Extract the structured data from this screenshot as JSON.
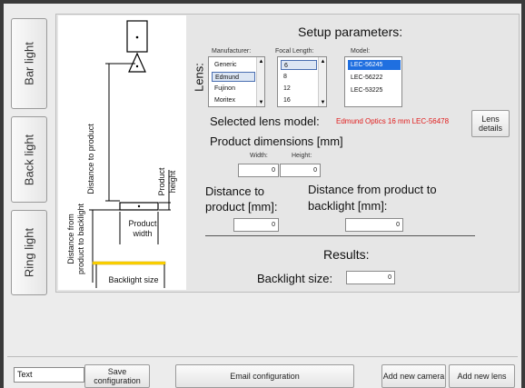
{
  "tabs": [
    "Bar light",
    "Back light",
    "Ring light"
  ],
  "diagram": {
    "distance_to_product": "Distance to product",
    "product_height_1": "Product",
    "product_height_2": "height",
    "distance_backlight_1": "Distance from",
    "distance_backlight_2": "product to backlight",
    "product_width_1": "Product",
    "product_width_2": "width",
    "backlight_size": "Backlight size"
  },
  "setup": {
    "title": "Setup parameters:",
    "lens_label": "Lens:",
    "manufacturer_header": "Manufacturer:",
    "focal_header": "Focal Length:",
    "model_header": "Model:",
    "manufacturers": [
      "Generic",
      "Edmund",
      "Fujinon",
      "Moritex"
    ],
    "focal_lengths": [
      "6",
      "8",
      "12",
      "16"
    ],
    "models": [
      "LEC-56245",
      "LEC-56222",
      "LEC-53225"
    ],
    "selected_label": "Selected lens model:",
    "selected_value": "Edmund Optics 16 mm LEC-56478",
    "lens_details_1": "Lens",
    "lens_details_2": "details",
    "product_dims_title": "Product dimensions [mm]",
    "width_label": "Width:",
    "height_label": "Height:",
    "width_value": "0",
    "height_value": "0",
    "dist_product_1": "Distance to",
    "dist_product_2": "product [mm]:",
    "dist_product_value": "0",
    "dist_backlight_1": "Distance from product to",
    "dist_backlight_2": "backlight [mm]:",
    "dist_backlight_value": "0"
  },
  "results": {
    "title": "Results:",
    "backlight_size_label": "Backlight size:",
    "backlight_size_value": "0"
  },
  "bottom": {
    "text_value": "Text",
    "save_1": "Save",
    "save_2": "configuration",
    "email": "Email configuration",
    "add_camera": "Add new camera",
    "add_lens": "Add new lens"
  }
}
